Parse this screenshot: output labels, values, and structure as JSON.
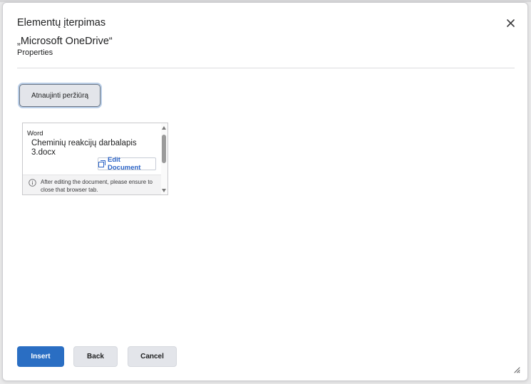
{
  "dialog": {
    "title": "Elementų įterpimas",
    "subtitle": "„Microsoft OneDrive“",
    "properties_label": "Properties",
    "close_icon": "close-icon"
  },
  "refresh_button": {
    "label": "Atnaujinti peržiūrą"
  },
  "preview": {
    "app_type": "Word",
    "document_name": "Cheminių reakcijų darbalapis 3.docx",
    "edit_button": {
      "label": "Edit Document",
      "icon": "external-edit-icon"
    },
    "notice": {
      "icon": "info-icon",
      "text": "After editing the document, please ensure to close that browser tab."
    }
  },
  "footer": {
    "insert_label": "Insert",
    "back_label": "Back",
    "cancel_label": "Cancel"
  },
  "colors": {
    "primary": "#2a6ec3",
    "secondary_button": "#e3e5ea",
    "link": "#2b63c6"
  }
}
